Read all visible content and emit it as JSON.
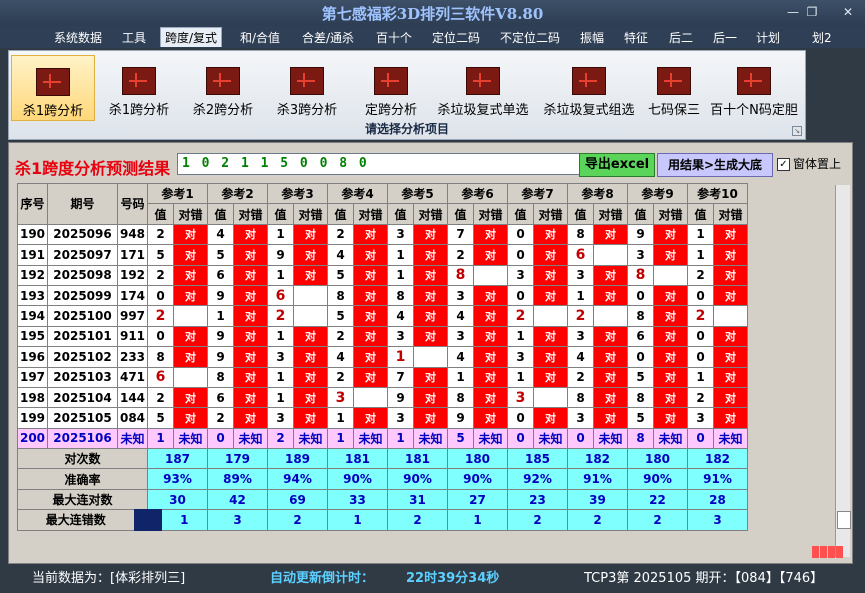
{
  "window": {
    "title": "第七感福彩3D排列三软件V8.80"
  },
  "menu": [
    "系统数据",
    "工具",
    "跨度/复式",
    "和/合值",
    "合差/通杀",
    "百十个",
    "定位二码",
    "不定位二码",
    "振幅",
    "特征",
    "后二",
    "后一",
    "计划",
    "划2"
  ],
  "menu_active": "跨度/复式",
  "ribbon": {
    "buttons": [
      "杀1跨分析",
      "杀1跨分析",
      "杀2跨分析",
      "杀3跨分析",
      "定跨分析",
      "杀垃圾复式单选",
      "杀垃圾复式组选",
      "七码保三",
      "百十个N码定胆"
    ],
    "group_label": "请选择分析项目"
  },
  "panel": {
    "heading": "杀1跨度分析预测结果",
    "numbers": "1 0 2 1 1 5 0 0 8 0",
    "export_button": "导出excel",
    "generate_button": "用结果>生成大底",
    "pin_label": "窗体置上",
    "pin_checked": "✓"
  },
  "table": {
    "headers": {
      "seq": "序号",
      "issue": "期号",
      "code": "号码",
      "val": "值",
      "judge": "对错"
    },
    "refs": [
      "参考1",
      "参考2",
      "参考3",
      "参考4",
      "参考5",
      "参考6",
      "参考7",
      "参考8",
      "参考9",
      "参考10"
    ],
    "rows": [
      {
        "seq": "190",
        "issue": "2025096",
        "code": "948",
        "vals": [
          "2",
          "4",
          "1",
          "2",
          "3",
          "7",
          "0",
          "8",
          "9",
          "1"
        ],
        "marks": [
          "对",
          "对",
          "对",
          "对",
          "对",
          "对",
          "对",
          "对",
          "对",
          "对"
        ],
        "hl": [
          0,
          0,
          0,
          0,
          0,
          0,
          0,
          0,
          0,
          0
        ]
      },
      {
        "seq": "191",
        "issue": "2025097",
        "code": "171",
        "vals": [
          "5",
          "5",
          "9",
          "4",
          "1",
          "2",
          "0",
          "6",
          "3",
          "1"
        ],
        "marks": [
          "对",
          "对",
          "对",
          "对",
          "对",
          "对",
          "对",
          "",
          "对",
          "对"
        ],
        "hl": [
          0,
          0,
          0,
          0,
          0,
          0,
          0,
          1,
          0,
          0
        ]
      },
      {
        "seq": "192",
        "issue": "2025098",
        "code": "192",
        "vals": [
          "2",
          "6",
          "1",
          "5",
          "1",
          "8",
          "3",
          "3",
          "8",
          "2"
        ],
        "marks": [
          "对",
          "对",
          "对",
          "对",
          "对",
          "",
          "对",
          "对",
          "",
          "对"
        ],
        "hl": [
          0,
          0,
          0,
          0,
          0,
          1,
          0,
          0,
          1,
          0
        ]
      },
      {
        "seq": "193",
        "issue": "2025099",
        "code": "174",
        "vals": [
          "0",
          "9",
          "6",
          "8",
          "8",
          "3",
          "0",
          "1",
          "0",
          "0"
        ],
        "marks": [
          "对",
          "对",
          "",
          "对",
          "对",
          "对",
          "对",
          "对",
          "对",
          "对"
        ],
        "hl": [
          0,
          0,
          1,
          0,
          0,
          0,
          0,
          0,
          0,
          0
        ]
      },
      {
        "seq": "194",
        "issue": "2025100",
        "code": "997",
        "vals": [
          "2",
          "1",
          "2",
          "5",
          "4",
          "4",
          "2",
          "2",
          "8",
          "2"
        ],
        "marks": [
          "",
          "对",
          "",
          "对",
          "对",
          "对",
          "",
          "",
          "对",
          ""
        ],
        "hl": [
          1,
          0,
          1,
          0,
          0,
          0,
          1,
          1,
          0,
          1
        ]
      },
      {
        "seq": "195",
        "issue": "2025101",
        "code": "911",
        "vals": [
          "0",
          "9",
          "1",
          "2",
          "3",
          "3",
          "1",
          "3",
          "6",
          "0"
        ],
        "marks": [
          "对",
          "对",
          "对",
          "对",
          "对",
          "对",
          "对",
          "对",
          "对",
          "对"
        ],
        "hl": [
          0,
          0,
          0,
          0,
          0,
          0,
          0,
          0,
          0,
          0
        ]
      },
      {
        "seq": "196",
        "issue": "2025102",
        "code": "233",
        "vals": [
          "8",
          "9",
          "3",
          "4",
          "1",
          "4",
          "3",
          "4",
          "0",
          "0"
        ],
        "marks": [
          "对",
          "对",
          "对",
          "对",
          "",
          "对",
          "对",
          "对",
          "对",
          "对"
        ],
        "hl": [
          0,
          0,
          0,
          0,
          1,
          0,
          0,
          0,
          0,
          0
        ]
      },
      {
        "seq": "197",
        "issue": "2025103",
        "code": "471",
        "vals": [
          "6",
          "8",
          "1",
          "2",
          "7",
          "1",
          "1",
          "2",
          "5",
          "1"
        ],
        "marks": [
          "",
          "对",
          "对",
          "对",
          "对",
          "对",
          "对",
          "对",
          "对",
          "对"
        ],
        "hl": [
          1,
          0,
          0,
          0,
          0,
          0,
          0,
          0,
          0,
          0
        ]
      },
      {
        "seq": "198",
        "issue": "2025104",
        "code": "144",
        "vals": [
          "2",
          "6",
          "1",
          "3",
          "9",
          "8",
          "3",
          "8",
          "8",
          "2"
        ],
        "marks": [
          "对",
          "对",
          "对",
          "",
          "对",
          "对",
          "",
          "对",
          "对",
          "对"
        ],
        "hl": [
          0,
          0,
          0,
          1,
          0,
          0,
          1,
          0,
          0,
          0
        ]
      },
      {
        "seq": "199",
        "issue": "2025105",
        "code": "084",
        "vals": [
          "5",
          "2",
          "3",
          "1",
          "3",
          "9",
          "0",
          "3",
          "5",
          "3"
        ],
        "marks": [
          "对",
          "对",
          "对",
          "对",
          "对",
          "对",
          "对",
          "对",
          "对",
          "对"
        ],
        "hl": [
          0,
          0,
          0,
          0,
          0,
          0,
          0,
          0,
          0,
          0
        ]
      },
      {
        "seq": "200",
        "issue": "2025106",
        "code": "未知",
        "vals": [
          "1",
          "0",
          "2",
          "1",
          "1",
          "5",
          "0",
          "0",
          "8",
          "0"
        ],
        "marks": [
          "未知",
          "未知",
          "未知",
          "未知",
          "未知",
          "未知",
          "未知",
          "未知",
          "未知",
          "未知"
        ],
        "pending": true
      }
    ],
    "stats": [
      {
        "label": "对次数",
        "values": [
          "187",
          "179",
          "189",
          "181",
          "181",
          "180",
          "185",
          "182",
          "180",
          "182"
        ]
      },
      {
        "label": "准确率",
        "values": [
          "93%",
          "89%",
          "94%",
          "90%",
          "90%",
          "90%",
          "92%",
          "91%",
          "90%",
          "91%"
        ]
      },
      {
        "label": "最大连对数",
        "values": [
          "30",
          "42",
          "69",
          "33",
          "31",
          "27",
          "23",
          "39",
          "22",
          "28"
        ]
      },
      {
        "label": "最大连错数",
        "values": [
          "1",
          "3",
          "2",
          "1",
          "2",
          "1",
          "2",
          "2",
          "2",
          "3"
        ]
      }
    ]
  },
  "status": {
    "current": "当前数据为：[体彩排列三]",
    "countdown_label": "自动更新倒计时：",
    "countdown": "22时39分34秒",
    "issue_info": "TCP3第 2025105 期开：【084】【746】"
  },
  "colors": {
    "hit": "#ff0000",
    "pending": "#ffc8ff",
    "stats": "#80ffff",
    "heading": "#e8000e"
  }
}
